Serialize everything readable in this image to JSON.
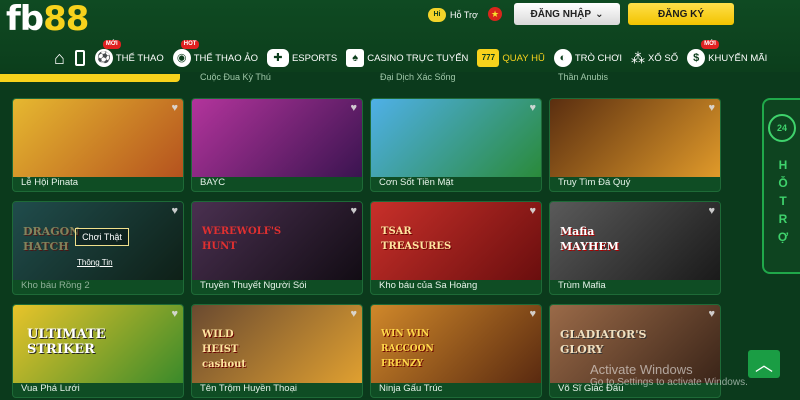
{
  "brand": {
    "logo_prefix": "fb",
    "logo_suffix": "88"
  },
  "header": {
    "support_label": "Hỗ Trợ",
    "support_bubble": "Hi",
    "login_label": "ĐĂNG NHẬP",
    "register_label": "ĐĂNG KÝ"
  },
  "nav": {
    "items": [
      {
        "label": "THỂ THAO",
        "badge": "MỚI",
        "icon": "soccer-ball-icon"
      },
      {
        "label": "THỂ THAO ẢO",
        "badge": "HOT",
        "icon": "virtual-sport-icon"
      },
      {
        "label": "ESPORTS",
        "badge": "",
        "icon": "gamepad-icon"
      },
      {
        "label": "CASINO TRỰC TUYẾN",
        "badge": "",
        "icon": "cards-icon"
      },
      {
        "label": "QUAY HŨ",
        "badge": "",
        "icon": "slot-777-icon",
        "icon_text": "777"
      },
      {
        "label": "TRÒ CHƠI",
        "badge": "",
        "icon": "games-icon"
      },
      {
        "label": "XỔ SỐ",
        "badge": "",
        "icon": "lottery-icon"
      },
      {
        "label": "KHUYẾN MÃI",
        "badge": "MỚI",
        "icon": "promo-dollar-icon"
      }
    ]
  },
  "previous_row": [
    "Cuộc Đua Kỳ Thú",
    "Đại Dịch Xác Sống",
    "Thần Anubis"
  ],
  "games": [
    {
      "title": "Lễ Hội Pinata",
      "art": "",
      "colors": [
        "#d9a52a",
        "#b5521e"
      ]
    },
    {
      "title": "BAYC",
      "art": "",
      "colors": [
        "#9c2a8c",
        "#3a1450"
      ]
    },
    {
      "title": "Cơn Sốt Tiền Mặt",
      "art": "",
      "colors": [
        "#3fa0d8",
        "#2a8a3a"
      ]
    },
    {
      "title": "Truy Tìm Đá Quý",
      "art": "",
      "colors": [
        "#6a3a12",
        "#d98a1a"
      ]
    },
    {
      "title": "Kho báu Rồng 2",
      "art": "DRAGON HATCH",
      "colors": [
        "#2a6a6a",
        "#1a3a2a"
      ],
      "dim": true
    },
    {
      "title": "Truyền Thuyết Người Sói",
      "art": "WEREWOLF'S HUNT",
      "colors": [
        "#3a2a3a",
        "#120c14"
      ]
    },
    {
      "title": "Kho báu của Sa Hoàng",
      "art": "TSAR TREASURES",
      "colors": [
        "#b8221e",
        "#6a0e0e"
      ]
    },
    {
      "title": "Trùm Mafia",
      "art": "Mafia MAYHEM",
      "colors": [
        "#4a4a4a",
        "#1a1a1a"
      ]
    },
    {
      "title": "Vua Phá Lưới",
      "art": "ULTIMATE STRIKER",
      "colors": [
        "#d8b41a",
        "#3a8a2a"
      ]
    },
    {
      "title": "Tên Trộm Huyền Thoại",
      "art": "WILD HEIST cashout",
      "colors": [
        "#5a3a2a",
        "#e0a030"
      ]
    },
    {
      "title": "Ninja Gấu Trúc",
      "art": "WIN WIN RACCOON FRENZY",
      "colors": [
        "#c07a20",
        "#5a2a10"
      ]
    },
    {
      "title": "Võ Sĩ Giác Đấu",
      "art": "GLADIATOR'S GLORY",
      "colors": [
        "#8a5a3a",
        "#3a2418"
      ]
    }
  ],
  "overlay": {
    "play_label": "Chơi Thật",
    "info_label": "Thông Tin"
  },
  "side": {
    "icon_text": "24",
    "vertical_label": [
      "H",
      "Ỗ",
      "T",
      "R",
      "Ợ"
    ]
  },
  "watermark": {
    "line1": "Activate Windows",
    "line2": "Go to Settings to activate Windows."
  },
  "colors": {
    "accent": "#f7d21c",
    "bg": "#0b3a1c",
    "green_button": "#1a9d44"
  }
}
